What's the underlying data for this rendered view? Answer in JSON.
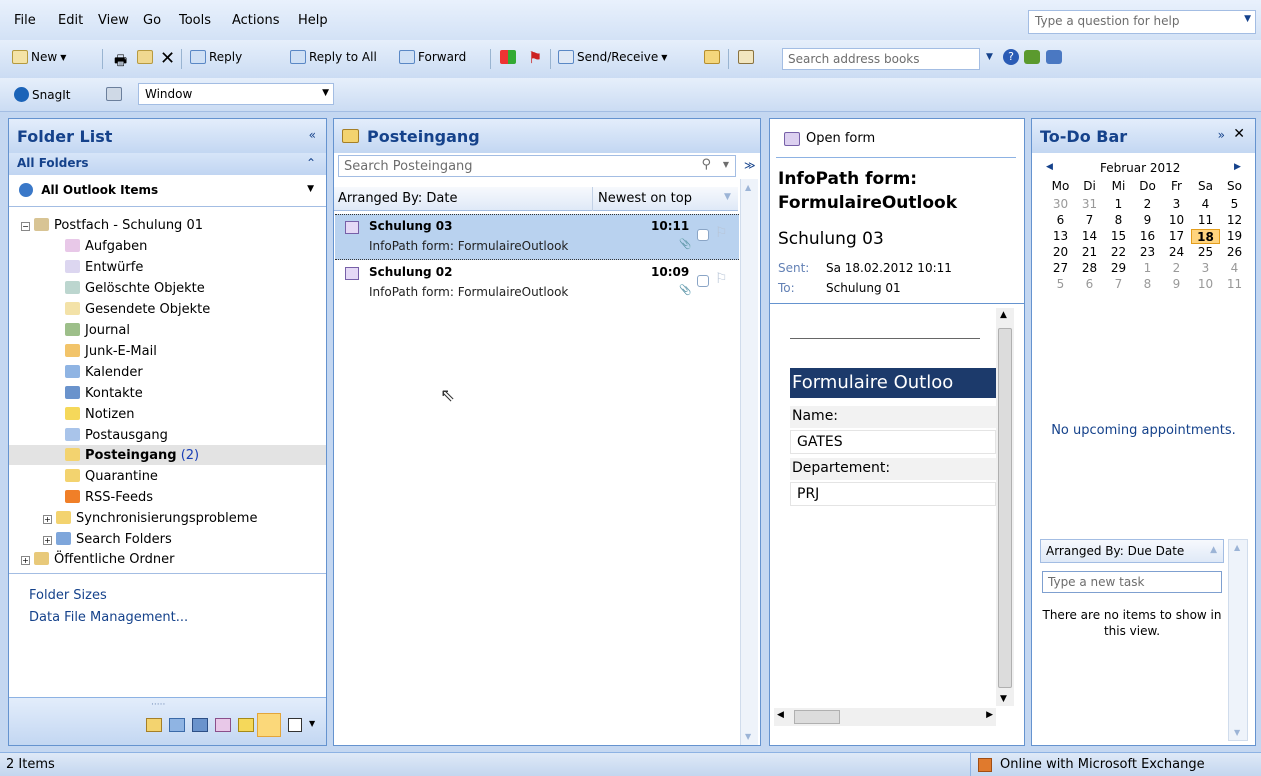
{
  "menu": [
    "File",
    "Edit",
    "View",
    "Go",
    "Tools",
    "Actions",
    "Help"
  ],
  "help_placeholder": "Type a question for help",
  "toolbar": {
    "new": "New",
    "reply": "Reply",
    "reply_all": "Reply to All",
    "forward": "Forward",
    "send_receive": "Send/Receive",
    "address_placeholder": "Search address books",
    "snagit": "SnagIt",
    "window": "Window"
  },
  "folder_list": {
    "title": "Folder List",
    "all_folders": "All Folders",
    "all_items": "All Outlook Items",
    "root": "Postfach - Schulung 01",
    "folders": [
      "Aufgaben",
      "Entwürfe",
      "Gelöschte Objekte",
      "Gesendete Objekte",
      "Journal",
      "Junk-E-Mail",
      "Kalender",
      "Kontakte",
      "Notizen",
      "Postausgang",
      "Posteingang",
      "Quarantine",
      "RSS-Feeds",
      "Synchronisierungsprobleme",
      "Search Folders"
    ],
    "inbox_count": "(2)",
    "public": "Öffentliche Ordner",
    "links": [
      "Folder Sizes",
      "Data File Management..."
    ]
  },
  "inbox": {
    "title": "Posteingang",
    "search_placeholder": "Search Posteingang",
    "arranged_by": "Arranged By: Date",
    "sort": "Newest on top",
    "messages": [
      {
        "from": "Schulung 03",
        "subject": "InfoPath form: FormulaireOutlook",
        "time": "10:11"
      },
      {
        "from": "Schulung 02",
        "subject": "InfoPath form: FormulaireOutlook",
        "time": "10:09"
      }
    ]
  },
  "reading": {
    "open_form": "Open form",
    "title": "InfoPath form: FormulaireOutlook",
    "from": "Schulung 03",
    "sent_label": "Sent:",
    "sent": "Sa 18.02.2012 10:11",
    "to_label": "To:",
    "to": "Schulung 01",
    "form_title": "Formulaire Outloo",
    "name_label": "Name:",
    "name_value": "GATES",
    "dept_label": "Departement:",
    "dept_value": "PRJ"
  },
  "todo": {
    "title": "To-Do Bar",
    "month": "Februar 2012",
    "weekdays": [
      "Mo",
      "Di",
      "Mi",
      "Do",
      "Fr",
      "Sa",
      "So"
    ],
    "weeks": [
      [
        "30",
        "31",
        "1",
        "2",
        "3",
        "4",
        "5"
      ],
      [
        "6",
        "7",
        "8",
        "9",
        "10",
        "11",
        "12"
      ],
      [
        "13",
        "14",
        "15",
        "16",
        "17",
        "18",
        "19"
      ],
      [
        "20",
        "21",
        "22",
        "23",
        "24",
        "25",
        "26"
      ],
      [
        "27",
        "28",
        "29",
        "1",
        "2",
        "3",
        "4"
      ],
      [
        "5",
        "6",
        "7",
        "8",
        "9",
        "10",
        "11"
      ]
    ],
    "today": "18",
    "no_appointments": "No upcoming appointments.",
    "task_arranged": "Arranged By: Due Date",
    "task_placeholder": "Type a new task",
    "task_empty": "There are no items to show in this view."
  },
  "status": {
    "items": "2 Items",
    "connection": "Online with Microsoft Exchange"
  }
}
